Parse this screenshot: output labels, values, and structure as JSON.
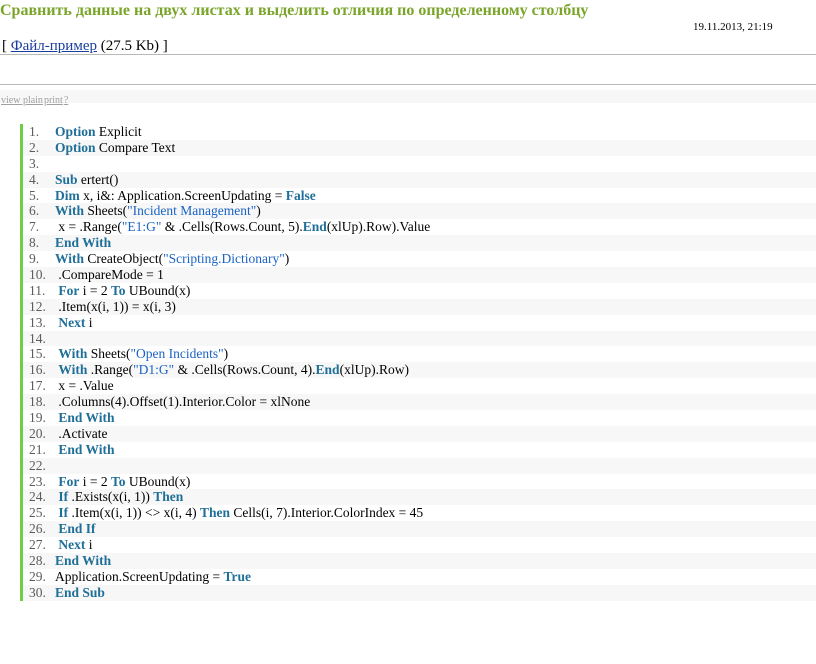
{
  "header": {
    "title": "Сравнить данные на двух листах и выделить отличия по определенному столбцу",
    "date": "19.11.2013, 21:19",
    "attach_prefix": "[ ",
    "attach_link": "Файл-пример",
    "attach_size": " (27.5 Kb) ]"
  },
  "toolbar": {
    "view_plain": "view plain",
    "print": "print",
    "help": "?"
  },
  "colors": {
    "title": "#7aa52a",
    "keyword": "#1f6f98",
    "string": "#1a62c4",
    "gutter": "#6ccf44"
  },
  "code_lines": [
    {
      "num": "1.",
      "tokens": [
        [
          "kw",
          "Option"
        ],
        [
          "t",
          " Explicit"
        ]
      ]
    },
    {
      "num": "2.",
      "tokens": [
        [
          "kw",
          "Option"
        ],
        [
          "t",
          " Compare Text"
        ]
      ]
    },
    {
      "num": "3.",
      "tokens": []
    },
    {
      "num": "4.",
      "tokens": [
        [
          "kw",
          "Sub"
        ],
        [
          "t",
          " ertert()"
        ]
      ]
    },
    {
      "num": "5.",
      "tokens": [
        [
          "kw",
          "Dim"
        ],
        [
          "t",
          " x, i&: Application.ScreenUpdating = "
        ],
        [
          "kw",
          "False"
        ]
      ]
    },
    {
      "num": "6.",
      "tokens": [
        [
          "kw",
          "With"
        ],
        [
          "t",
          " Sheets("
        ],
        [
          "s",
          "\"Incident Management\""
        ],
        [
          "t",
          ")"
        ]
      ]
    },
    {
      "num": "7.",
      "tokens": [
        [
          "t",
          " x = .Range("
        ],
        [
          "s",
          "\"E1:G\""
        ],
        [
          "t",
          " & .Cells(Rows.Count, 5)."
        ],
        [
          "kw",
          "End"
        ],
        [
          "t",
          "(xlUp).Row).Value"
        ]
      ]
    },
    {
      "num": "8.",
      "tokens": [
        [
          "kw",
          "End With"
        ]
      ]
    },
    {
      "num": "9.",
      "tokens": [
        [
          "kw",
          "With"
        ],
        [
          "t",
          " CreateObject("
        ],
        [
          "s",
          "\"Scripting.Dictionary\""
        ],
        [
          "t",
          ")"
        ]
      ]
    },
    {
      "num": "10.",
      "tokens": [
        [
          "t",
          " .CompareMode = 1"
        ]
      ]
    },
    {
      "num": "11.",
      "tokens": [
        [
          "t",
          " "
        ],
        [
          "kw",
          "For"
        ],
        [
          "t",
          " i = 2 "
        ],
        [
          "kw",
          "To"
        ],
        [
          "t",
          " UBound(x)"
        ]
      ]
    },
    {
      "num": "12.",
      "tokens": [
        [
          "t",
          " .Item(x(i, 1)) = x(i, 3)"
        ]
      ]
    },
    {
      "num": "13.",
      "tokens": [
        [
          "t",
          " "
        ],
        [
          "kw",
          "Next"
        ],
        [
          "t",
          " i"
        ]
      ]
    },
    {
      "num": "14.",
      "tokens": []
    },
    {
      "num": "15.",
      "tokens": [
        [
          "t",
          " "
        ],
        [
          "kw",
          "With"
        ],
        [
          "t",
          " Sheets("
        ],
        [
          "s",
          "\"Open Incidents\""
        ],
        [
          "t",
          ")"
        ]
      ]
    },
    {
      "num": "16.",
      "tokens": [
        [
          "t",
          " "
        ],
        [
          "kw",
          "With"
        ],
        [
          "t",
          " .Range("
        ],
        [
          "s",
          "\"D1:G\""
        ],
        [
          "t",
          " & .Cells(Rows.Count, 4)."
        ],
        [
          "kw",
          "End"
        ],
        [
          "t",
          "(xlUp).Row)"
        ]
      ]
    },
    {
      "num": "17.",
      "tokens": [
        [
          "t",
          " x = .Value"
        ]
      ]
    },
    {
      "num": "18.",
      "tokens": [
        [
          "t",
          " .Columns(4).Offset(1).Interior.Color = xlNone"
        ]
      ]
    },
    {
      "num": "19.",
      "tokens": [
        [
          "t",
          " "
        ],
        [
          "kw",
          "End With"
        ]
      ]
    },
    {
      "num": "20.",
      "tokens": [
        [
          "t",
          " .Activate"
        ]
      ]
    },
    {
      "num": "21.",
      "tokens": [
        [
          "t",
          " "
        ],
        [
          "kw",
          "End With"
        ]
      ]
    },
    {
      "num": "22.",
      "tokens": []
    },
    {
      "num": "23.",
      "tokens": [
        [
          "t",
          " "
        ],
        [
          "kw",
          "For"
        ],
        [
          "t",
          " i = 2 "
        ],
        [
          "kw",
          "To"
        ],
        [
          "t",
          " UBound(x)"
        ]
      ]
    },
    {
      "num": "24.",
      "tokens": [
        [
          "t",
          " "
        ],
        [
          "kw",
          "If"
        ],
        [
          "t",
          " .Exists(x(i, 1)) "
        ],
        [
          "kw",
          "Then"
        ]
      ]
    },
    {
      "num": "25.",
      "tokens": [
        [
          "t",
          " "
        ],
        [
          "kw",
          "If"
        ],
        [
          "t",
          " .Item(x(i, 1)) <> x(i, 4) "
        ],
        [
          "kw",
          "Then"
        ],
        [
          "t",
          " Cells(i, 7).Interior.ColorIndex = 45"
        ]
      ]
    },
    {
      "num": "26.",
      "tokens": [
        [
          "t",
          " "
        ],
        [
          "kw",
          "End If"
        ]
      ]
    },
    {
      "num": "27.",
      "tokens": [
        [
          "t",
          " "
        ],
        [
          "kw",
          "Next"
        ],
        [
          "t",
          " i"
        ]
      ]
    },
    {
      "num": "28.",
      "tokens": [
        [
          "kw",
          "End With"
        ]
      ]
    },
    {
      "num": "29.",
      "tokens": [
        [
          "t",
          "Application.ScreenUpdating = "
        ],
        [
          "kw",
          "True"
        ]
      ]
    },
    {
      "num": "30.",
      "tokens": [
        [
          "kw",
          "End Sub"
        ]
      ]
    }
  ]
}
